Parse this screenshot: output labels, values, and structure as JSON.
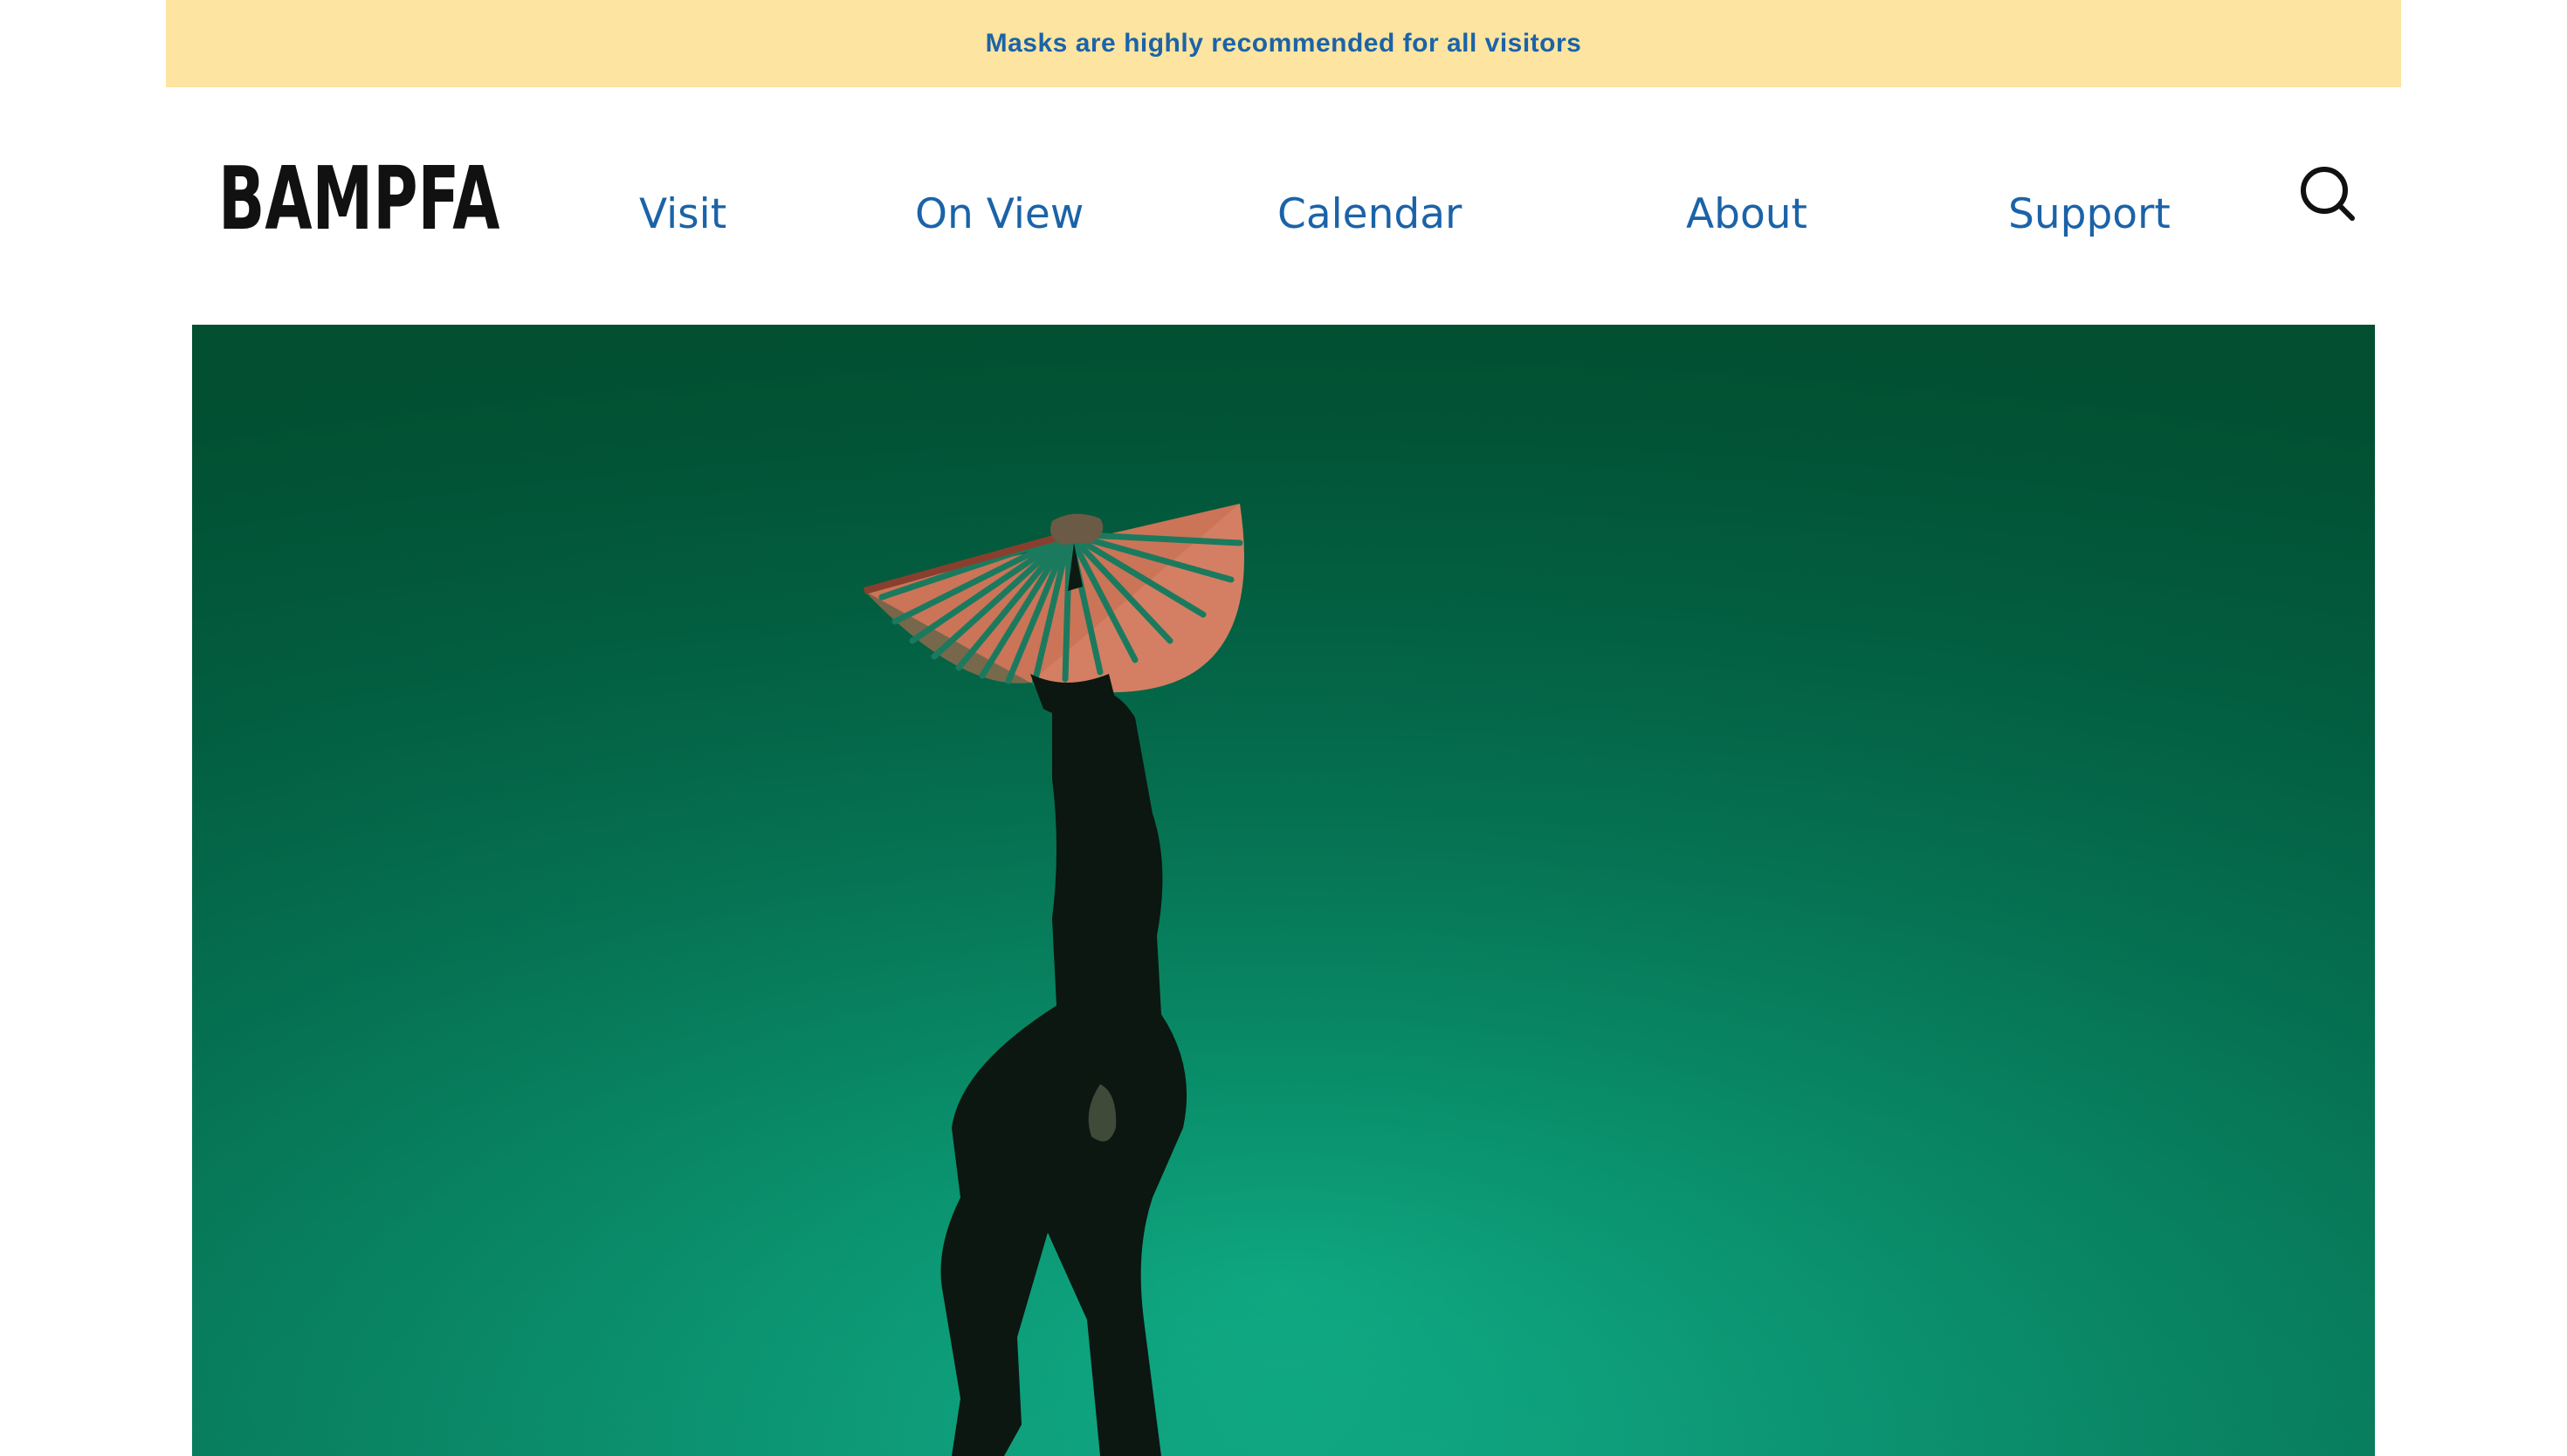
{
  "alert": {
    "message": "Masks are highly recommended for all visitors"
  },
  "header": {
    "logo_text": "BAMPFA",
    "nav": [
      {
        "label": "Visit"
      },
      {
        "label": "On View"
      },
      {
        "label": "Calendar"
      },
      {
        "label": "About"
      },
      {
        "label": "Support"
      }
    ],
    "search_icon": "search-icon"
  },
  "hero": {
    "image": "dancer-with-fan-on-green-background"
  },
  "colors": {
    "alert_background": "#fde4a0",
    "link_blue": "#1b63a8",
    "hero_green": "#0a9a73",
    "logo_black": "#111111"
  }
}
